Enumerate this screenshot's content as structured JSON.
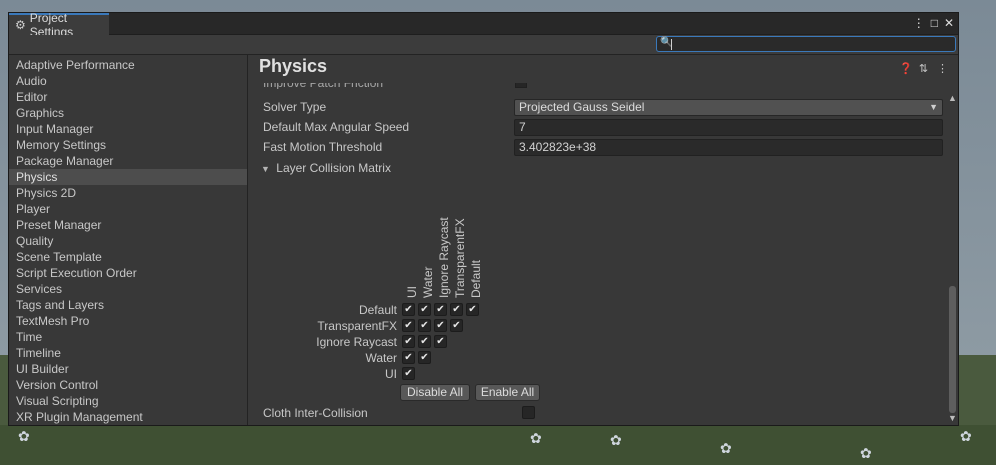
{
  "window": {
    "tab_title": "Project Settings",
    "controls": [
      "⋮",
      "□",
      "✕"
    ]
  },
  "search": {
    "value": "",
    "placeholder": ""
  },
  "sidebar": {
    "items": [
      {
        "label": "Adaptive Performance"
      },
      {
        "label": "Audio"
      },
      {
        "label": "Editor"
      },
      {
        "label": "Graphics"
      },
      {
        "label": "Input Manager"
      },
      {
        "label": "Memory Settings"
      },
      {
        "label": "Package Manager"
      },
      {
        "label": "Physics",
        "selected": true
      },
      {
        "label": "Physics 2D"
      },
      {
        "label": "Player"
      },
      {
        "label": "Preset Manager"
      },
      {
        "label": "Quality"
      },
      {
        "label": "Scene Template"
      },
      {
        "label": "Script Execution Order"
      },
      {
        "label": "Services"
      },
      {
        "label": "Tags and Layers"
      },
      {
        "label": "TextMesh Pro"
      },
      {
        "label": "Time"
      },
      {
        "label": "Timeline"
      },
      {
        "label": "UI Builder"
      },
      {
        "label": "Version Control"
      },
      {
        "label": "Visual Scripting"
      },
      {
        "label": "XR Plugin Management"
      }
    ]
  },
  "content": {
    "title": "Physics",
    "cutoff_row": "Improve Patch Friction",
    "solver_type": {
      "label": "Solver Type",
      "value": "Projected Gauss Seidel"
    },
    "max_angular_speed": {
      "label": "Default Max Angular Speed",
      "value": "7"
    },
    "fast_motion": {
      "label": "Fast Motion Threshold",
      "value": "3.402823e+38"
    },
    "matrix_foldout": "Layer Collision Matrix",
    "matrix": {
      "columns": [
        "UI",
        "Water",
        "Ignore Raycast",
        "TransparentFX",
        "Default"
      ],
      "rows": [
        "Default",
        "TransparentFX",
        "Ignore Raycast",
        "Water",
        "UI"
      ],
      "disable_all": "Disable All",
      "enable_all": "Enable All"
    },
    "cloth": {
      "label": "Cloth Inter-Collision",
      "checked": false
    }
  },
  "icons": {
    "gear": "gear-icon",
    "help": "help-icon",
    "preset": "preset-icon",
    "more": "more-icon"
  },
  "colors": {
    "accent": "#3a79bb",
    "selected": "#4d4d4d"
  }
}
